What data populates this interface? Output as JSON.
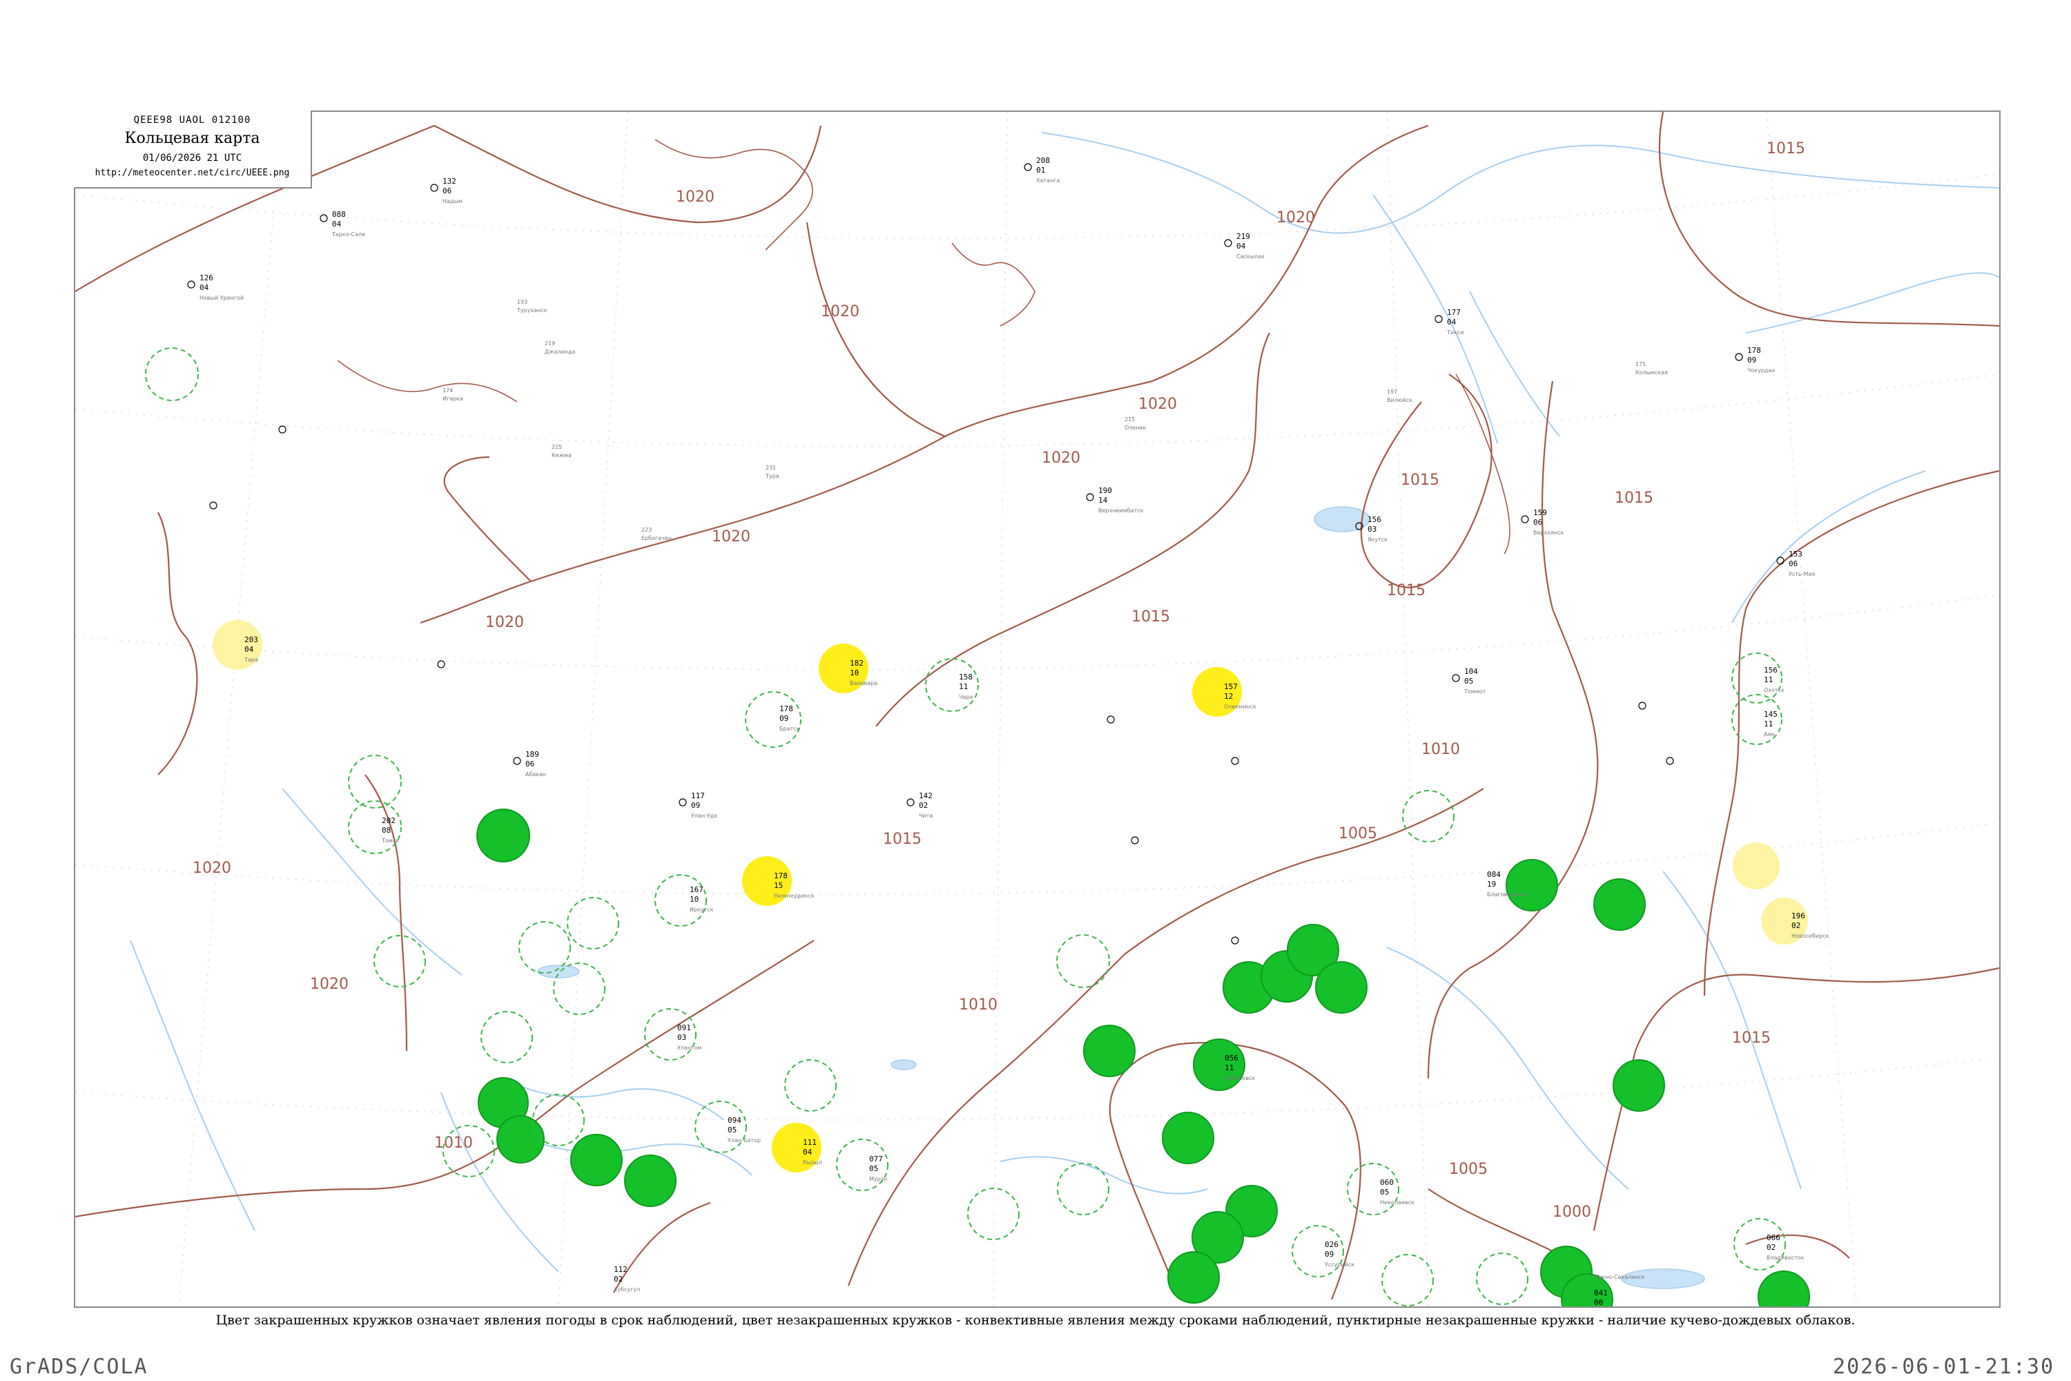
{
  "header": {
    "code": "QEEE98  UAOL  012100",
    "title": "Кольцевая карта",
    "time": "01/06/2026 21 UTC",
    "url": "http://meteocenter.net/circ/UEEE.png"
  },
  "caption": "Цвет закрашенных кружков означает явления погоды в срок наблюдений, цвет незакрашенных кружков - конвективные явления между сроками наблюдений, пунктирные незакрашенные кружки - наличие кучево-дождевых облаков.",
  "footer": {
    "software": "GrADS/COLA",
    "timestamp": "2026-06-01-21:30"
  },
  "colors": {
    "isobar": "#a15a4a",
    "water": "#a8cff0",
    "convective_dashed": "#3cb54a",
    "weather_green": "#15c02a",
    "weather_yellow": "#ffee1a",
    "pale_yellow": "#fdf3a0"
  },
  "isobars": [
    "1020",
    "1020",
    "1020",
    "1020",
    "1020",
    "1020",
    "1020",
    "1020",
    "1020",
    "1015",
    "1015",
    "1015",
    "1015",
    "1015",
    "1015",
    "1015",
    "1010",
    "1010",
    "1010",
    "1005",
    "1005",
    "1005",
    "1000"
  ],
  "legend_marks": {
    "filled_green": "weather at observation time",
    "dashed_green": "cumulonimbus present",
    "yellow": "convective phenomena between observations"
  },
  "stations": [
    {
      "p": "088",
      "t": "04",
      "name": "Тарко-Сале"
    },
    {
      "p": "132",
      "t": "06",
      "name": "Надым"
    },
    {
      "p": "126",
      "t": "04",
      "name": "Новый Уренгой"
    },
    {
      "p": "174",
      "t": "03",
      "name": "Игарка"
    },
    {
      "p": "208",
      "t": "01",
      "name": "Хатанга"
    },
    {
      "p": "219",
      "t": "04",
      "name": "Саскылах"
    },
    {
      "p": "177",
      "t": "04",
      "name": "Тикси"
    },
    {
      "p": "178",
      "t": "09",
      "name": "Чокурдах"
    },
    {
      "p": "193",
      "t": "06",
      "name": "Туруханск"
    },
    {
      "p": "190",
      "t": "14",
      "name": "Верхнеимбатск"
    },
    {
      "p": "219",
      "t": "09",
      "name": "Джалинда"
    },
    {
      "p": "175",
      "t": "23",
      "name": "Колымская"
    },
    {
      "p": "215",
      "t": "07",
      "name": "Оленек"
    },
    {
      "p": "197",
      "t": "05",
      "name": "Вилюйск"
    },
    {
      "p": "231",
      "t": "14",
      "name": "Тура"
    },
    {
      "p": "225",
      "t": "16",
      "name": "Кежма"
    },
    {
      "p": "223",
      "t": "14",
      "name": "Ербогачен"
    },
    {
      "p": "159",
      "t": "06",
      "name": "Верхоянск"
    },
    {
      "p": "153",
      "t": "06",
      "name": "Усть-Мая"
    },
    {
      "p": "156",
      "t": "03",
      "name": "Якутск"
    },
    {
      "p": "157",
      "t": "12",
      "name": "Олекминск"
    },
    {
      "p": "182",
      "t": "10",
      "name": "Ванавара"
    },
    {
      "p": "178",
      "t": "09",
      "name": "Братск"
    },
    {
      "p": "178",
      "t": "15",
      "name": "Нижнеудинск"
    },
    {
      "p": "158",
      "t": "11",
      "name": "Чара"
    },
    {
      "p": "104",
      "t": "05",
      "name": "Томмот"
    },
    {
      "p": "145",
      "t": "11",
      "name": "Аян"
    },
    {
      "p": "156",
      "t": "11",
      "name": "Охотск"
    },
    {
      "p": "202",
      "t": "08",
      "name": "Томск"
    },
    {
      "p": "196",
      "t": "02",
      "name": "Новосибирск"
    },
    {
      "p": "203",
      "t": "04",
      "name": "Тара"
    },
    {
      "p": "189",
      "t": "06",
      "name": "Абакан"
    },
    {
      "p": "167",
      "t": "10",
      "name": "Иркутск"
    },
    {
      "p": "117",
      "t": "09",
      "name": "Улан-Удэ"
    },
    {
      "p": "142",
      "t": "02",
      "name": "Чита"
    },
    {
      "p": "084",
      "t": "19",
      "name": "Благовещенск"
    },
    {
      "p": "056",
      "t": "11",
      "name": "Хабаровск"
    },
    {
      "p": "066",
      "t": "02",
      "name": "Владивосток"
    },
    {
      "p": "060",
      "t": "05",
      "name": "Николаевск"
    },
    {
      "p": "041",
      "t": "00",
      "name": "Южно-Сахалинск"
    },
    {
      "p": "026",
      "t": "09",
      "name": "Уссурийск"
    },
    {
      "p": "111",
      "t": "04",
      "name": "Кызыл"
    },
    {
      "p": "091",
      "t": "03",
      "name": "Улангом"
    },
    {
      "p": "077",
      "t": "05",
      "name": "Мурэн"
    },
    {
      "p": "094",
      "t": "05",
      "name": "Улан-Батор"
    },
    {
      "p": "112",
      "t": "02",
      "name": "Хубсугул"
    }
  ]
}
